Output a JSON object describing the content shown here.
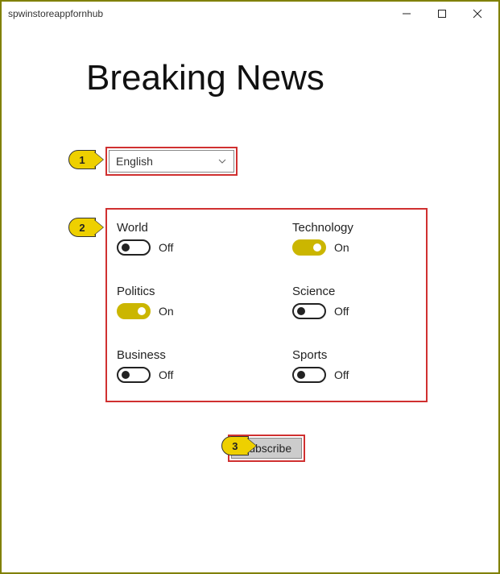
{
  "window": {
    "title": "spwinstoreappfornhub"
  },
  "header": {
    "title": "Breaking News"
  },
  "callouts": {
    "one": "1",
    "two": "2",
    "three": "3"
  },
  "language": {
    "selected": "English"
  },
  "toggles": {
    "on_text": "On",
    "off_text": "Off",
    "items": [
      {
        "label": "World",
        "on": false
      },
      {
        "label": "Technology",
        "on": true
      },
      {
        "label": "Politics",
        "on": true
      },
      {
        "label": "Science",
        "on": false
      },
      {
        "label": "Business",
        "on": false
      },
      {
        "label": "Sports",
        "on": false
      }
    ]
  },
  "actions": {
    "subscribe_label": "Subscribe"
  }
}
